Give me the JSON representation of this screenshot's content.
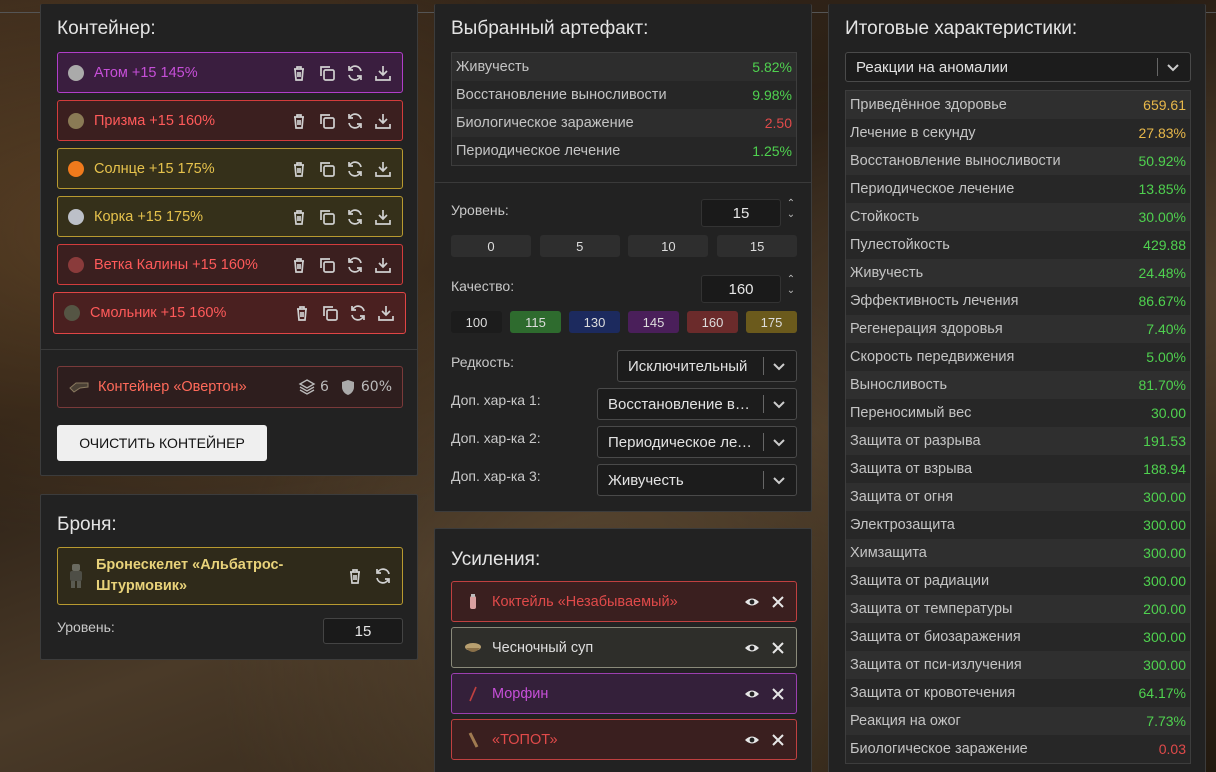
{
  "colors": {
    "green": "#4fd14f",
    "yellow": "#e8b84a",
    "red": "#e04a4a"
  },
  "container": {
    "title": "Контейнер:",
    "items": [
      {
        "label": "Атом +15 145%",
        "color": "#c64fd8",
        "border": "#b03ec9",
        "bg": "#3a1e3f",
        "thumb": "#aaaaaa",
        "icon": "atom-artifact-icon"
      },
      {
        "label": "Призма +15 160%",
        "color": "#ff5a5a",
        "border": "#d23c3c",
        "bg": "#3b1f1f",
        "thumb": "#8a7a55",
        "icon": "prism-artifact-icon"
      },
      {
        "label": "Солнце +15 175%",
        "color": "#e6c24c",
        "border": "#b89a30",
        "bg": "#35301a",
        "thumb": "#f07a1c",
        "icon": "sun-artifact-icon"
      },
      {
        "label": "Корка +15 175%",
        "color": "#e6c24c",
        "border": "#b89a30",
        "bg": "#35301a",
        "thumb": "#bcc0c8",
        "icon": "crust-artifact-icon"
      },
      {
        "label": "Ветка Калины +15 160%",
        "color": "#ff5a5a",
        "border": "#d23c3c",
        "bg": "#3b1f1f",
        "thumb": "#8a3b3b",
        "icon": "viburnum-artifact-icon"
      },
      {
        "label": "Смольник +15 160%",
        "color": "#ff5a5a",
        "border": "#e04545",
        "bg": "#4a2020",
        "thumb": "#555544",
        "icon": "resin-artifact-icon"
      }
    ],
    "actions": [
      "delete-icon",
      "copy-icon",
      "refresh-icon",
      "download-icon"
    ],
    "box": {
      "label": "Контейнер «Овертон»",
      "slots": "6",
      "protection": "60%"
    },
    "clear_button": "ОЧИСТИТЬ КОНТЕЙНЕР"
  },
  "armor": {
    "title": "Броня:",
    "item": "Бронескелет «Альбатрос-Штурмовик»",
    "level_label": "Уровень:",
    "level_value": "15"
  },
  "artifact": {
    "title": "Выбранный артефакт:",
    "stats": [
      {
        "k": "Живучесть",
        "v": "5.82%",
        "c": "green"
      },
      {
        "k": "Восстановление выносливости",
        "v": "9.98%",
        "c": "green"
      },
      {
        "k": "Биологическое заражение",
        "v": "2.50",
        "c": "red"
      },
      {
        "k": "Периодическое лечение",
        "v": "1.25%",
        "c": "green"
      }
    ],
    "level_label": "Уровень:",
    "level_value": "15",
    "level_presets": [
      "0",
      "5",
      "10",
      "15"
    ],
    "quality_label": "Качество:",
    "quality_value": "160",
    "quality_presets": [
      {
        "v": "100",
        "bg": "#1c1c1c"
      },
      {
        "v": "115",
        "bg": "#2e6b2e"
      },
      {
        "v": "130",
        "bg": "#1c2a5e"
      },
      {
        "v": "145",
        "bg": "#4a1f5a"
      },
      {
        "v": "160",
        "bg": "#6b2b2b"
      },
      {
        "v": "175",
        "bg": "#6b5a1c"
      }
    ],
    "rarity_label": "Редкость:",
    "rarity_value": "Исключительный",
    "extra1_label": "Доп. хар-ка 1:",
    "extra1_value": "Восстановление выносливости",
    "extra2_label": "Доп. хар-ка 2:",
    "extra2_value": "Периодическое лечение",
    "extra3_label": "Доп. хар-ка 3:",
    "extra3_value": "Живучесть"
  },
  "boosts": {
    "title": "Усиления:",
    "items": [
      {
        "label": "Коктейль «Незабываемый»",
        "color": "#e04a4a",
        "border": "#c04040",
        "bg": "#3a1f1f",
        "icon": "cocktail-icon"
      },
      {
        "label": "Чесночный суп",
        "color": "#dedede",
        "border": "#8a8a7a",
        "bg": "#2e2e2a",
        "icon": "soup-icon"
      },
      {
        "label": "Морфин",
        "color": "#c64fd8",
        "border": "#9b3fb0",
        "bg": "#34203a",
        "icon": "syringe-icon"
      },
      {
        "label": "«ТОПОТ»",
        "color": "#e04a4a",
        "border": "#c04040",
        "bg": "#3a1f1f",
        "icon": "stim-icon"
      }
    ]
  },
  "totals": {
    "title": "Итоговые характеристики:",
    "filter": "Реакции на аномалии",
    "stats": [
      {
        "k": "Приведённое здоровье",
        "v": "659.61",
        "c": "yellow"
      },
      {
        "k": "Лечение в секунду",
        "v": "27.83%",
        "c": "yellow"
      },
      {
        "k": "Восстановление выносливости",
        "v": "50.92%",
        "c": "green"
      },
      {
        "k": "Периодическое лечение",
        "v": "13.85%",
        "c": "green"
      },
      {
        "k": "Стойкость",
        "v": "30.00%",
        "c": "green"
      },
      {
        "k": "Пулестойкость",
        "v": "429.88",
        "c": "green"
      },
      {
        "k": "Живучесть",
        "v": "24.48%",
        "c": "green"
      },
      {
        "k": "Эффективность лечения",
        "v": "86.67%",
        "c": "green"
      },
      {
        "k": "Регенерация здоровья",
        "v": "7.40%",
        "c": "green"
      },
      {
        "k": "Скорость передвижения",
        "v": "5.00%",
        "c": "green"
      },
      {
        "k": "Выносливость",
        "v": "81.70%",
        "c": "green"
      },
      {
        "k": "Переносимый вес",
        "v": "30.00",
        "c": "green"
      },
      {
        "k": "Защита от разрыва",
        "v": "191.53",
        "c": "green"
      },
      {
        "k": "Защита от взрыва",
        "v": "188.94",
        "c": "green"
      },
      {
        "k": "Защита от огня",
        "v": "300.00",
        "c": "green"
      },
      {
        "k": "Электрозащита",
        "v": "300.00",
        "c": "green"
      },
      {
        "k": "Химзащита",
        "v": "300.00",
        "c": "green"
      },
      {
        "k": "Защита от радиации",
        "v": "300.00",
        "c": "green"
      },
      {
        "k": "Защита от температуры",
        "v": "200.00",
        "c": "green"
      },
      {
        "k": "Защита от биозаражения",
        "v": "300.00",
        "c": "green"
      },
      {
        "k": "Защита от пси-излучения",
        "v": "300.00",
        "c": "green"
      },
      {
        "k": "Защита от кровотечения",
        "v": "64.17%",
        "c": "green"
      },
      {
        "k": "Реакция на ожог",
        "v": "7.73%",
        "c": "green"
      },
      {
        "k": "Биологическое заражение",
        "v": "0.03",
        "c": "red"
      }
    ]
  }
}
